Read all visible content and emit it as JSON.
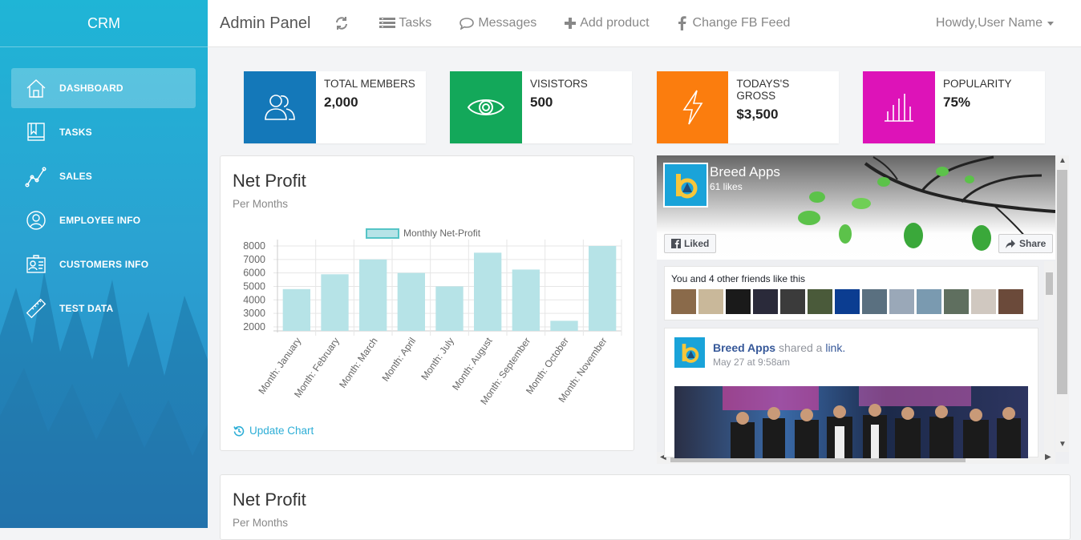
{
  "sidebar": {
    "brand": "CRM",
    "items": [
      {
        "label": "DASHBOARD",
        "active": true
      },
      {
        "label": "TASKS"
      },
      {
        "label": "SALES"
      },
      {
        "label": "EMPLOYEE INFO"
      },
      {
        "label": "CUSTOMERS INFO"
      },
      {
        "label": "TEST DATA"
      }
    ]
  },
  "topbar": {
    "title": "Admin Panel",
    "tasks": "Tasks",
    "messages": "Messages",
    "add_product": "Add product",
    "change_fb": "Change FB Feed",
    "user": "Howdy,User Name"
  },
  "stats": [
    {
      "label": "TOTAL MEMBERS",
      "value": "2,000",
      "color": "#1478b9"
    },
    {
      "label": "VISISTORS",
      "value": "500",
      "color": "#13a85a"
    },
    {
      "label": "TODAYS'S GROSS",
      "value": "$3,500",
      "color": "#fb7d0e"
    },
    {
      "label": "POPULARITY",
      "value": "75%",
      "color": "#dd13b8"
    }
  ],
  "panel1": {
    "title": "Net Profit",
    "subtitle": "Per Months",
    "update": "Update Chart"
  },
  "panel2": {
    "title": "Net Profit",
    "subtitle": "Per Months"
  },
  "chart_data": {
    "type": "bar",
    "legend": "Monthly Net-Profit",
    "categories": [
      "Month: January",
      "Month: February",
      "Month: March",
      "Month: April",
      "Month: July",
      "Month: August",
      "Month: September",
      "Month: October",
      "Month: November"
    ],
    "values": [
      4800,
      5900,
      7000,
      6000,
      5000,
      7500,
      6250,
      2450,
      8000
    ],
    "yticks": [
      2000,
      3000,
      4000,
      5000,
      6000,
      7000,
      8000
    ],
    "ylim": [
      1700,
      8000
    ],
    "bar_color": "#b6e3e7",
    "legend_color": "#55c4c6"
  },
  "fb": {
    "page_name": "Breed Apps",
    "likes": "61 likes",
    "liked": "Liked",
    "share": "Share",
    "friends_text": "You and 4 other friends like this",
    "post_name": "Breed Apps",
    "post_action": "shared a",
    "post_link": "link.",
    "post_date": "May 27 at 9:58am"
  }
}
